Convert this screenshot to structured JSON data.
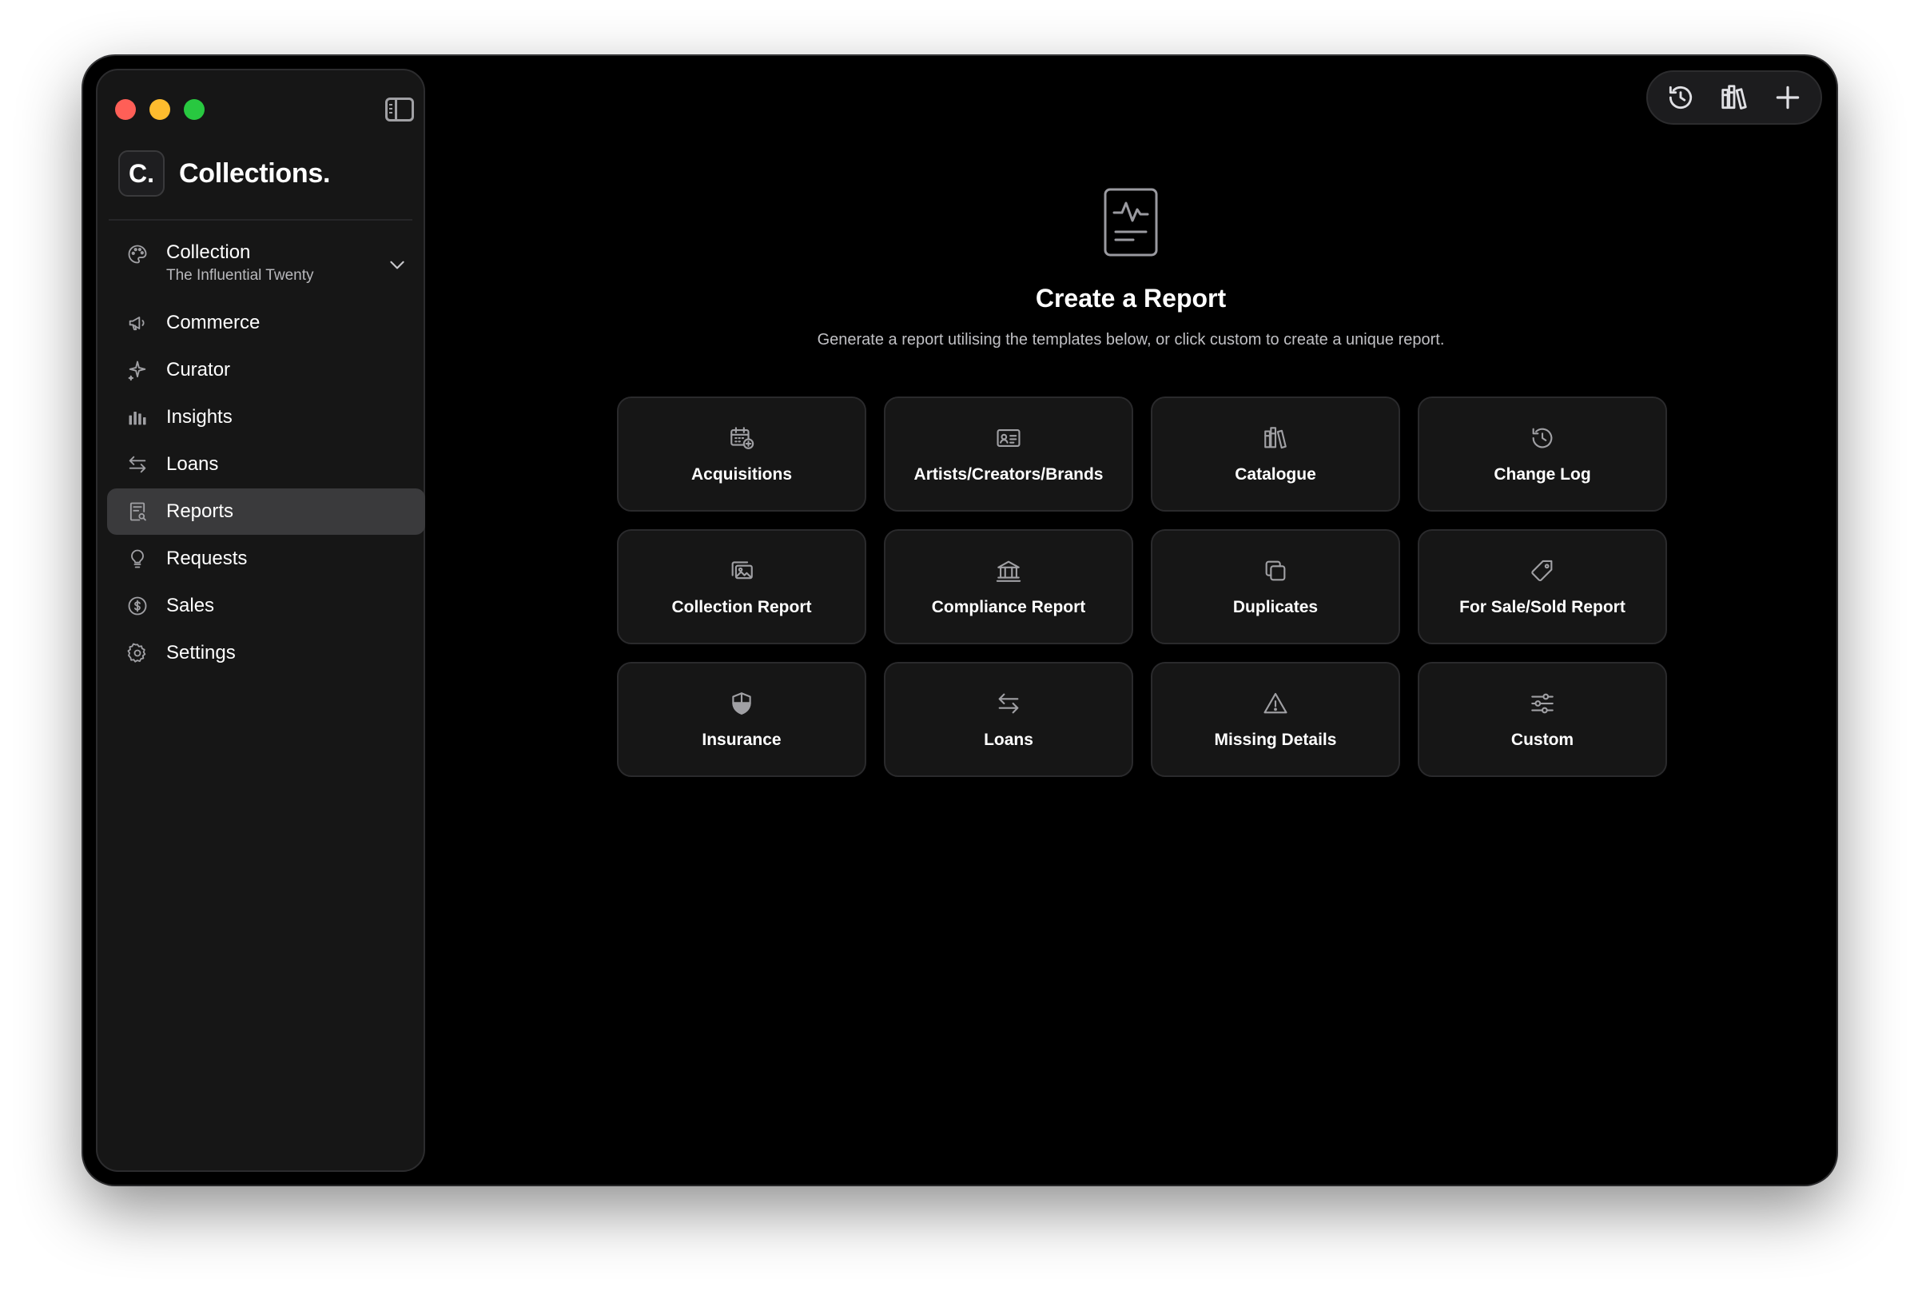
{
  "brand": {
    "logo_letter": "C.",
    "name": "Collections."
  },
  "sidebar": {
    "collection": {
      "label": "Collection",
      "subtitle": "The Influential Twenty",
      "icon": "palette-icon"
    },
    "items": [
      {
        "label": "Commerce",
        "icon": "megaphone-icon"
      },
      {
        "label": "Curator",
        "icon": "sparkle-icon"
      },
      {
        "label": "Insights",
        "icon": "bar-chart-icon"
      },
      {
        "label": "Loans",
        "icon": "arrows-exchange-icon"
      },
      {
        "label": "Reports",
        "icon": "report-search-icon",
        "active": true
      },
      {
        "label": "Requests",
        "icon": "lightbulb-icon"
      },
      {
        "label": "Sales",
        "icon": "dollar-circle-icon"
      },
      {
        "label": "Settings",
        "icon": "gear-icon"
      }
    ]
  },
  "toolbar": {
    "buttons": [
      "history-icon",
      "library-icon",
      "plus-icon"
    ]
  },
  "main": {
    "title": "Create a Report",
    "subtitle": "Generate a report utilising the templates below, or click custom to create a unique report.",
    "templates": [
      {
        "label": "Acquisitions",
        "icon": "calendar-add-icon"
      },
      {
        "label": "Artists/Creators/Brands",
        "icon": "id-card-icon"
      },
      {
        "label": "Catalogue",
        "icon": "books-icon"
      },
      {
        "label": "Change Log",
        "icon": "history-icon"
      },
      {
        "label": "Collection Report",
        "icon": "photos-icon"
      },
      {
        "label": "Compliance Report",
        "icon": "bank-icon"
      },
      {
        "label": "Duplicates",
        "icon": "duplicate-icon"
      },
      {
        "label": "For Sale/Sold Report",
        "icon": "tag-icon"
      },
      {
        "label": "Insurance",
        "icon": "shield-icon"
      },
      {
        "label": "Loans",
        "icon": "arrows-exchange-icon"
      },
      {
        "label": "Missing Details",
        "icon": "warning-icon"
      },
      {
        "label": "Custom",
        "icon": "sliders-icon"
      }
    ]
  },
  "colors": {
    "background": "#000000",
    "sidebar": "#161616",
    "active_item": "#3a3a3c",
    "card": "#161616"
  }
}
